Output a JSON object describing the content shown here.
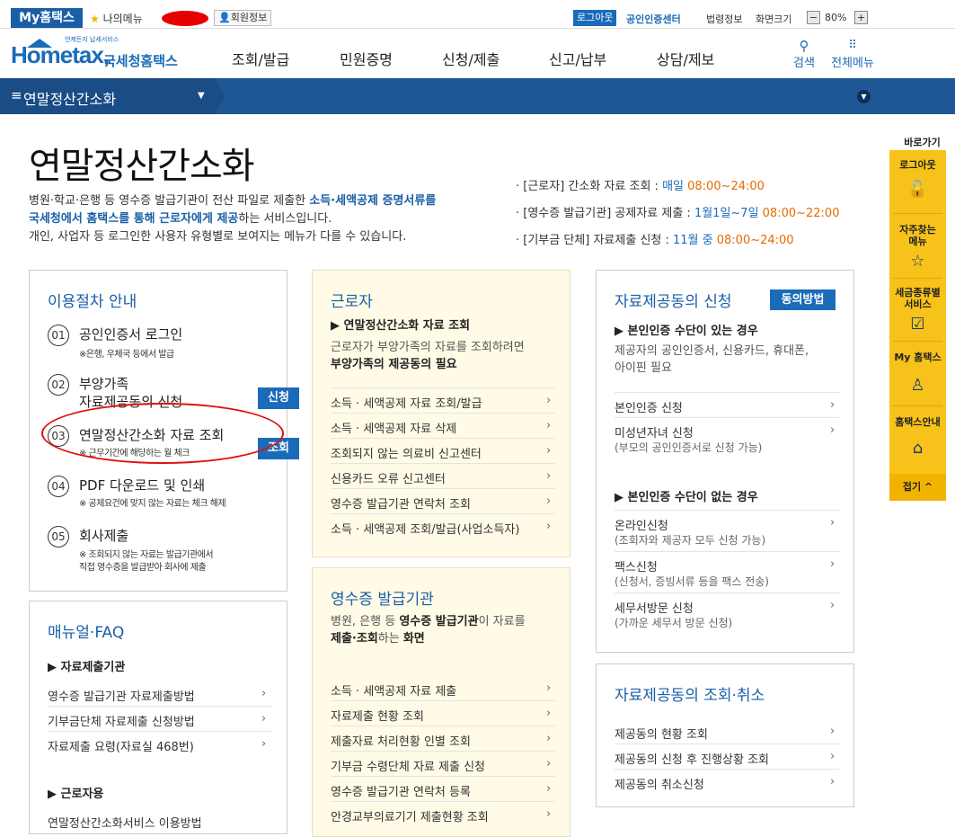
{
  "topbar": {
    "my_hometax": "My홈택스",
    "my_menu": "나의메뉴",
    "member_info": "회원정보",
    "logout": "로그아웃",
    "cert_center": "공인인증센터",
    "legal_info": "법령정보",
    "screen_size": "화면크기",
    "zoom_minus": "−",
    "zoom_value": "80%",
    "zoom_plus": "+"
  },
  "header": {
    "logo_small": "언제든지 납세서비스",
    "logo_main": "Hometax,",
    "logo_kr": "국세청홈택스",
    "nav": [
      "조회/발급",
      "민원증명",
      "신청/제출",
      "신고/납부",
      "상담/제보"
    ],
    "search": "검색",
    "all_menu": "전체메뉴"
  },
  "bluebar": {
    "title": "연말정산간소화"
  },
  "page": {
    "title": "연말정산간소화",
    "desc_line1_a": "병원·학교·은행 등 영수증 발급기관이 전산 파일로 제출한 ",
    "desc_line1_b": "소득·세액공제 증명서류를",
    "desc_line2_a": "국세청에서 홈택스를 통해 근로자에게 제공",
    "desc_line2_b": "하는 서비스입니다.",
    "desc_line3": "개인, 사업자 등 로그인한 사용자 유형별로 보여지는 메뉴가 다를 수 있습니다."
  },
  "notices": [
    {
      "label": "· [근로자] 간소화 자료 조회 : ",
      "period": "매일 ",
      "time": "08:00~24:00"
    },
    {
      "label": "· [영수증 발급기관] 공제자료 제출 : ",
      "period": "1월1일~7일 ",
      "time": "08:00~22:00"
    },
    {
      "label": "· [기부금 단체] 자료제출 신청 : ",
      "period": "11월 중 ",
      "time": "08:00~24:00"
    }
  ],
  "procedure": {
    "title": "이용절차 안내",
    "steps": [
      {
        "num": "01",
        "title": "공인인증서 로그인",
        "note": "※은행, 우체국 등에서 발급"
      },
      {
        "num": "02",
        "title": "부양가족",
        "title2": "자료제공동의 신청",
        "button": "신청"
      },
      {
        "num": "03",
        "title": "연말정산간소화 자료 조회",
        "note": "※ 근무기간에 해당하는 월 체크",
        "button": "조회"
      },
      {
        "num": "04",
        "title": "PDF 다운로드 및 인쇄",
        "note": "※ 공제요건에 맞지 않는 자료는 체크 해제"
      },
      {
        "num": "05",
        "title": "회사제출",
        "note": "※ 조회되지 않는 자료는 발급기관에서",
        "note2": "직접 영수증을 발급받아 회사에 제출"
      }
    ]
  },
  "manual": {
    "title": "매뉴얼·FAQ",
    "sub1": "▶ 자료제출기관",
    "links": [
      "영수증 발급기관 자료제출방법",
      "기부금단체 자료제출 신청방법",
      "자료제출 요령(자료실 468번)"
    ],
    "sub2": "▶ 근로자용",
    "partial": "연말정산간소화서비스 이용방법"
  },
  "worker": {
    "title": "근로자",
    "sub": "▶ 연말정산간소화 자료 조회",
    "text1": "근로자가 부양가족의 자료를 조회하려면",
    "text2": "부양가족의 제공동의 필요",
    "links": [
      "소득 · 세액공제 자료 조회/발급",
      "소득 · 세액공제 자료 삭제",
      "조회되지 않는 의료비 신고센터",
      "신용카드 오류 신고센터",
      "영수증 발급기관 연락처 조회",
      "소득 · 세액공제 조회/발급(사업소득자)"
    ]
  },
  "issuer": {
    "title": "영수증 발급기관",
    "text1a": "병원, 은행 등 ",
    "text1b": "영수증 발급기관",
    "text1c": "이 자료를",
    "text2a": "제출·조회",
    "text2b": "하는 ",
    "text2c": "화면",
    "links": [
      "소득 · 세액공제 자료 제출",
      "자료제출 현황 조회",
      "제출자료 처리현황 인별 조회",
      "기부금 수령단체 자료 제출 신청",
      "영수증 발급기관 연락처 등록",
      "안경교부의료기기 제출현황 조회"
    ]
  },
  "consent": {
    "title": "자료제공동의 신청",
    "button": "동의방법",
    "sub1": "▶ 본인인증 수단이 있는 경우",
    "text1": "제공자의 공인인증서, 신용카드, 휴대폰,",
    "text2": "아이핀 필요",
    "links1": [
      {
        "label": "본인인증 신청"
      },
      {
        "label": "미성년자녀 신청",
        "note": "(부모의 공인인증서로 신청 가능)"
      }
    ],
    "sub2": "▶ 본인인증 수단이 없는 경우",
    "links2": [
      {
        "label": "온라인신청",
        "note": "(조회자와 제공자 모두 신청 가능)"
      },
      {
        "label": "팩스신청",
        "note": "(신청서, 증빙서류 등을 팩스 전송)"
      },
      {
        "label": "세무서방문 신청",
        "note": "(가까운 세무서 방문 신청)"
      }
    ]
  },
  "consent_query": {
    "title": "자료제공동의 조회·취소",
    "links": [
      "제공동의 현황 조회",
      "제공동의 신청 후 진행상황 조회",
      "제공동의 취소신청"
    ]
  },
  "quick": {
    "title": "바로가기",
    "items": [
      "로그아웃",
      "자주찾는",
      "메뉴",
      "세금종류별",
      "서비스",
      "My 홈택스",
      "홈택스안내"
    ],
    "close": "접기 ^"
  }
}
